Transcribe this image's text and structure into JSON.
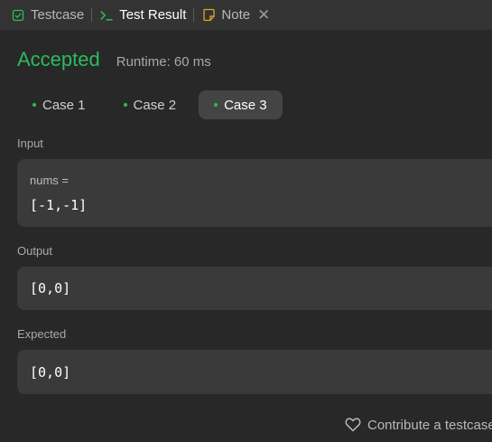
{
  "tabs": {
    "testcase": "Testcase",
    "test_result": "Test Result",
    "note": "Note"
  },
  "result": {
    "status": "Accepted",
    "runtime": "Runtime: 60 ms"
  },
  "cases": [
    "Case 1",
    "Case 2",
    "Case 3"
  ],
  "selected_case": "Case 3",
  "input": {
    "label": "Input",
    "var_name": "nums =",
    "value": "[-1,-1]"
  },
  "output": {
    "label": "Output",
    "value": "[0,0]"
  },
  "expected": {
    "label": "Expected",
    "value": "[0,0]"
  },
  "footer": {
    "contribute": "Contribute a testcase"
  },
  "colors": {
    "accepted_green": "#2cbb5d",
    "panel_bg": "#282828",
    "box_bg": "#3a3a3a",
    "note_icon": "#e0a526"
  },
  "icons": {
    "testcase": "checkbox-icon",
    "test_result": "terminal-icon",
    "note": "note-icon",
    "close": "close-icon",
    "contribute": "heart-icon"
  }
}
